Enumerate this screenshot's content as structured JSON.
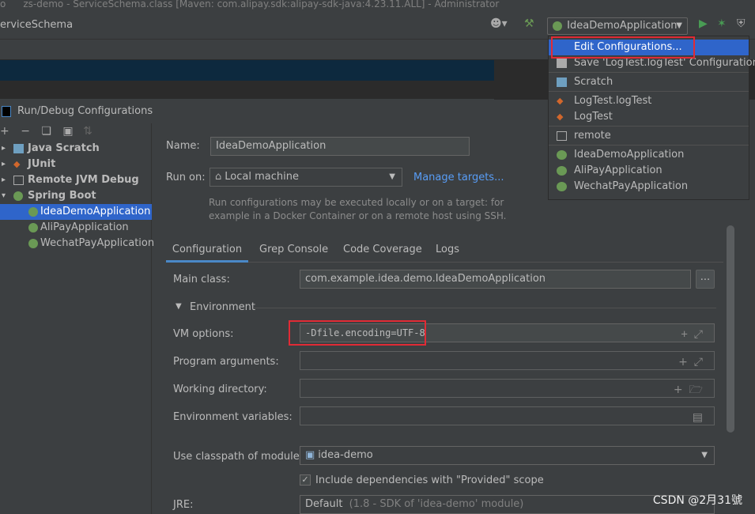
{
  "window": {
    "title": "zs-demo - ServiceSchema.class [Maven: com.alipay.sdk:alipay-sdk-java:4.23.11.ALL] - Administrator",
    "title_prefix": "o",
    "breadcrumb": "erviceSchema",
    "run_config_selected": "IdeaDemoApplication"
  },
  "dialog": {
    "title": "Run/Debug Configurations",
    "tree": [
      {
        "label": "Java Scratch",
        "bold": true
      },
      {
        "label": "JUnit",
        "bold": true
      },
      {
        "label": "Remote JVM Debug",
        "bold": true
      },
      {
        "label": "Spring Boot",
        "bold": true
      },
      {
        "label": "IdeaDemoApplication",
        "selected": true
      },
      {
        "label": "AliPayApplication"
      },
      {
        "label": "WechatPayApplication"
      }
    ],
    "name_label": "Name:",
    "name_value": "IdeaDemoApplication",
    "run_on_label": "Run on:",
    "run_on_value": "Local machine",
    "manage_targets": "Manage targets...",
    "hint_line1": "Run configurations may be executed locally or on a target: for",
    "hint_line2": "example in a Docker Container or on a remote host using SSH.",
    "tabs": [
      "Configuration",
      "Grep Console",
      "Code Coverage",
      "Logs"
    ],
    "active_tab": "Configuration",
    "main_class_label": "Main class:",
    "main_class_value": "com.example.idea.demo.IdeaDemoApplication",
    "browse_label": "...",
    "environment_label": "Environment",
    "vm_options_label": "VM options:",
    "vm_options_value": "-Dfile.encoding=UTF-8",
    "program_args_label": "Program arguments:",
    "working_dir_label": "Working directory:",
    "env_vars_label": "Environment variables:",
    "classpath_label": "Use classpath of module:",
    "classpath_value": "idea-demo",
    "include_deps_label": "Include dependencies with \"Provided\" scope",
    "include_deps_checked": true,
    "jre_label": "JRE:",
    "jre_value": "Default",
    "jre_detail": "(1.8 - SDK of 'idea-demo' module)"
  },
  "popup": {
    "items": [
      {
        "label": "Edit Configurations...",
        "selected": true,
        "icon": "none"
      },
      {
        "label": "Save 'LogTest.logTest' Configuration",
        "icon": "save-icon"
      },
      {
        "label": "Scratch",
        "icon": "scratch-icon"
      },
      {
        "label": "LogTest.logTest",
        "icon": "junit-icon"
      },
      {
        "label": "LogTest",
        "icon": "junit-icon"
      },
      {
        "label": "remote",
        "icon": "remote-icon"
      },
      {
        "label": "IdeaDemoApplication",
        "icon": "spring-icon"
      },
      {
        "label": "AliPayApplication",
        "icon": "spring-icon"
      },
      {
        "label": "WechatPayApplication",
        "icon": "spring-icon"
      }
    ]
  },
  "watermark": "CSDN @2月31號",
  "colors": {
    "accent": "#2f65ca",
    "highlight_box": "#e12b35",
    "spring": "#6a9955"
  }
}
